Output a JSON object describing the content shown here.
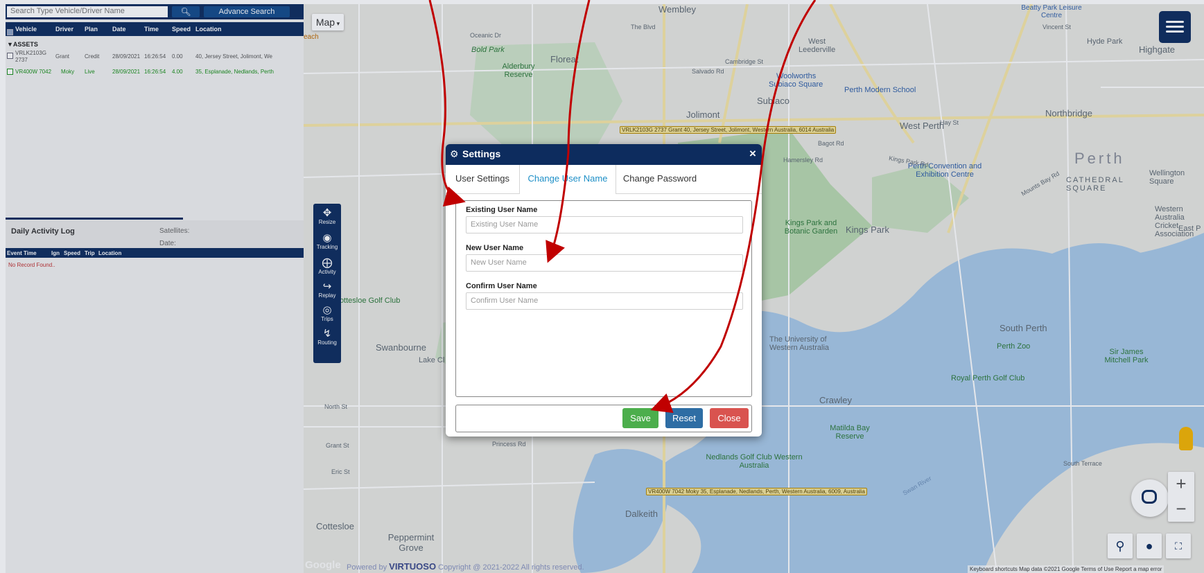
{
  "left_panel": {
    "search": {
      "placeholder": "Search Type Vehicle/Driver Name",
      "search_icon": "search-icon",
      "advance_label": "Advance Search"
    },
    "vehicle_table": {
      "headers": [
        "Vehicle",
        "Driver",
        "Plan",
        "Date",
        "Time",
        "Speed",
        "Location"
      ],
      "group_label": "ASSETS",
      "rows": [
        {
          "vehicle_line1": "VRLK2103G",
          "vehicle_line2": "2737",
          "driver": "Grant",
          "plan": "Credit",
          "date": "28/09/2021",
          "time": "16:26:54",
          "speed": "0.00",
          "location": "40, Jersey Street, Jolimont, We"
        },
        {
          "vehicle": "VR400W 7042",
          "driver": "Moky",
          "plan": "Live",
          "date": "28/09/2021",
          "time": "16:26:54",
          "speed": "4.00",
          "location": "35, Esplanade, Nedlands, Perth"
        }
      ]
    },
    "activity_log": {
      "title": "Daily Activity Log",
      "satellites_label": "Satellites:",
      "date_label": "Date:",
      "headers": [
        "Event Time",
        "Ign",
        "Speed",
        "Trip",
        "Location"
      ],
      "empty_text": "No Record Found.."
    }
  },
  "map": {
    "type_button": "Map",
    "tools": [
      {
        "label": "Resize",
        "icon": "resize-icon"
      },
      {
        "label": "Tracking",
        "icon": "map-pin-icon"
      },
      {
        "label": "Activity",
        "icon": "crosshair-icon"
      },
      {
        "label": "Replay",
        "icon": "replay-icon"
      },
      {
        "label": "Trips",
        "icon": "trips-icon"
      },
      {
        "label": "Routing",
        "icon": "routing-icon"
      }
    ],
    "labels": {
      "wembley": "Wembley",
      "west_leederville": "West\nLeederville",
      "floreat": "Floreat",
      "bold_park": "Bold Park",
      "alderbury_reserve": "Alderbury Reserve",
      "woolworths": "Woolworths",
      "subiaco_square": "Subiaco Square",
      "subiaco": "Subiaco",
      "jolimont": "Jolimont",
      "west_perth": "West Perth",
      "northbridge": "Northbridge",
      "perth": "Perth",
      "perth_modern_school": "Perth Modern School",
      "kings_park": "Kings Park",
      "kings_park_botanic": "Kings Park and Botanic Garden",
      "perth_convention": "Perth Convention and Exhibition Centre",
      "cathedral_square": "CATHEDRAL SQUARE",
      "highgate": "Highgate",
      "hyde_park": "Hyde Park",
      "wellington_square": "Wellington Square",
      "western_australia_cricket": "Western Australia Cricket Association",
      "east_perth": "East P",
      "south_perth": "South Perth",
      "perth_zoo": "Perth Zoo",
      "sir_james_mitchell_park": "Sir James Mitchell Park",
      "royal_perth_golf_club": "Royal Perth Golf Club",
      "cottesloe_golf_club": "Cottesloe Golf Club",
      "swanbourne": "Swanbourne",
      "lake_claremont": "Lake Cl",
      "university": "The University of Western Australia",
      "crawley": "Crawley",
      "matilda_bay": "Matilda Bay Reserve",
      "nedlands_golf_club": "Nedlands Golf Club Western Australia",
      "dalkeith": "Dalkeith",
      "cottesloe": "Cottesloe",
      "peppermint_grove": "Peppermint Grove",
      "swan_river": "Swan River",
      "beatty_park": "Beatty Park Leisure Centre",
      "vincent_st": "Vincent St",
      "south_terrace": "South Terrace",
      "north_st": "North St",
      "grant_st": "Grant St",
      "eric_st": "Eric St",
      "salvado_rd": "Salvado Rd",
      "cambridge_st": "Cambridge St",
      "bagot_rd": "Bagot Rd",
      "hamersley_rd": "Hamersley Rd",
      "princess_rd": "Princess Rd",
      "kings_park_rd": "Kings Park Rd",
      "the_blvd": "The Blvd",
      "oceanic_dr": "Oceanic Dr",
      "hay_st": "Hay St",
      "mounts_bay_rd": "Mounts Bay Rd",
      "beach": "each"
    },
    "vehicle_tags": [
      "VRLK2103G 2737 Grant 40, Jersey Street, Jolimont, Western Australia, 6014 Australia",
      "VR400W 7042 Moky 35, Esplanade, Nedlands, Perth, Western Australia, 6009, Australia"
    ],
    "footer": {
      "google": "Google",
      "powered_prefix": "Powered by",
      "brand": "VIRTUOSO",
      "copyright": "Copyright @ 2021-2022 All rights reserved.",
      "attribution": "Keyboard shortcuts   Map data ©2021 Google   Terms of Use   Report a map error"
    },
    "controls": {
      "zoom_in": "+",
      "zoom_out": "−"
    }
  },
  "dialog": {
    "title": "Settings",
    "close_glyph": "×",
    "tabs": [
      {
        "label": "User Settings",
        "active": false
      },
      {
        "label": "Change User Name",
        "active": true
      },
      {
        "label": "Change Password",
        "active": false
      }
    ],
    "fields": [
      {
        "label": "Existing User Name",
        "placeholder": "Existing User Name"
      },
      {
        "label": "New User Name",
        "placeholder": "New User Name"
      },
      {
        "label": "Confirm User Name",
        "placeholder": "Confirm User Name"
      }
    ],
    "buttons": {
      "save": "Save",
      "reset": "Reset",
      "close": "Close"
    }
  },
  "colors": {
    "navy": "#0d2c5e",
    "save_green": "#4cae4c",
    "reset_blue": "#2e6da4",
    "close_red": "#d9534f",
    "active_tab": "#1d8fc7",
    "annotation_arrow": "#c00000"
  }
}
